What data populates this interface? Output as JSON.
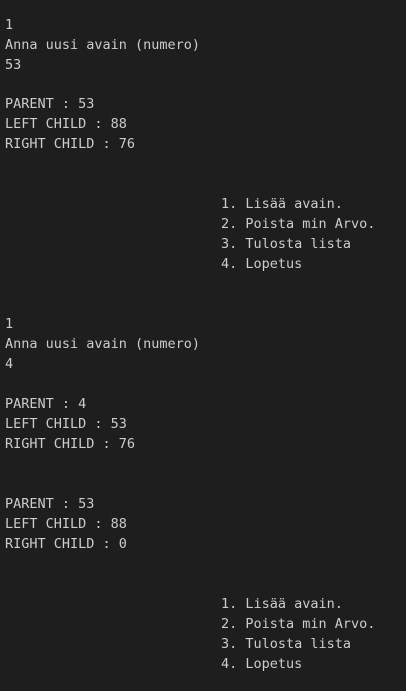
{
  "terminal": {
    "lines": [
      "1",
      "Anna uusi avain (numero)",
      "53",
      "",
      "PARENT : 53",
      "LEFT CHILD : 88",
      "RIGHT CHILD : 76",
      "",
      "",
      "",
      "1. Lisää avain.",
      "2. Poista min Arvo.",
      "3. Tulosta lista",
      "4. Lopetus",
      "",
      "",
      "1",
      "Anna uusi avain (numero)",
      "4",
      "",
      "PARENT : 4",
      "LEFT CHILD : 53",
      "RIGHT CHILD : 76",
      "",
      "",
      "PARENT : 53",
      "LEFT CHILD : 88",
      "RIGHT CHILD : 0",
      "",
      "",
      "",
      "1. Lisää avain.",
      "2. Poista min Arvo.",
      "3. Tulosta lista",
      "4. Lopetus"
    ]
  }
}
